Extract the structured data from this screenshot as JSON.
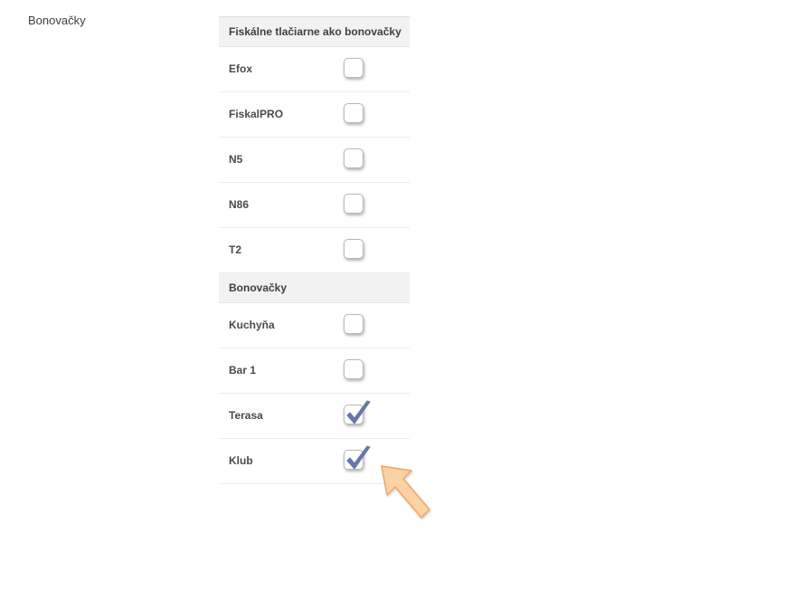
{
  "section": {
    "label": "Bonovačky"
  },
  "groups": [
    {
      "header": "Fiskálne tlačiarne ako bonovačky",
      "items": [
        {
          "label": "Efox",
          "checked": false
        },
        {
          "label": "FiskalPRO",
          "checked": false
        },
        {
          "label": "N5",
          "checked": false
        },
        {
          "label": "N86",
          "checked": false
        },
        {
          "label": "T2",
          "checked": false
        }
      ]
    },
    {
      "header": "Bonovačky",
      "items": [
        {
          "label": "Kuchyňa",
          "checked": false
        },
        {
          "label": "Bar 1",
          "checked": false
        },
        {
          "label": "Terasa",
          "checked": true
        },
        {
          "label": "Klub",
          "checked": true
        }
      ]
    }
  ],
  "colors": {
    "checkmark": "#6677aa",
    "arrow_fill": "#fbd1a6",
    "arrow_stroke": "#f2a35f"
  },
  "icons": {
    "checkmark": "checkmark-icon",
    "pointer": "pointer-arrow-icon"
  }
}
